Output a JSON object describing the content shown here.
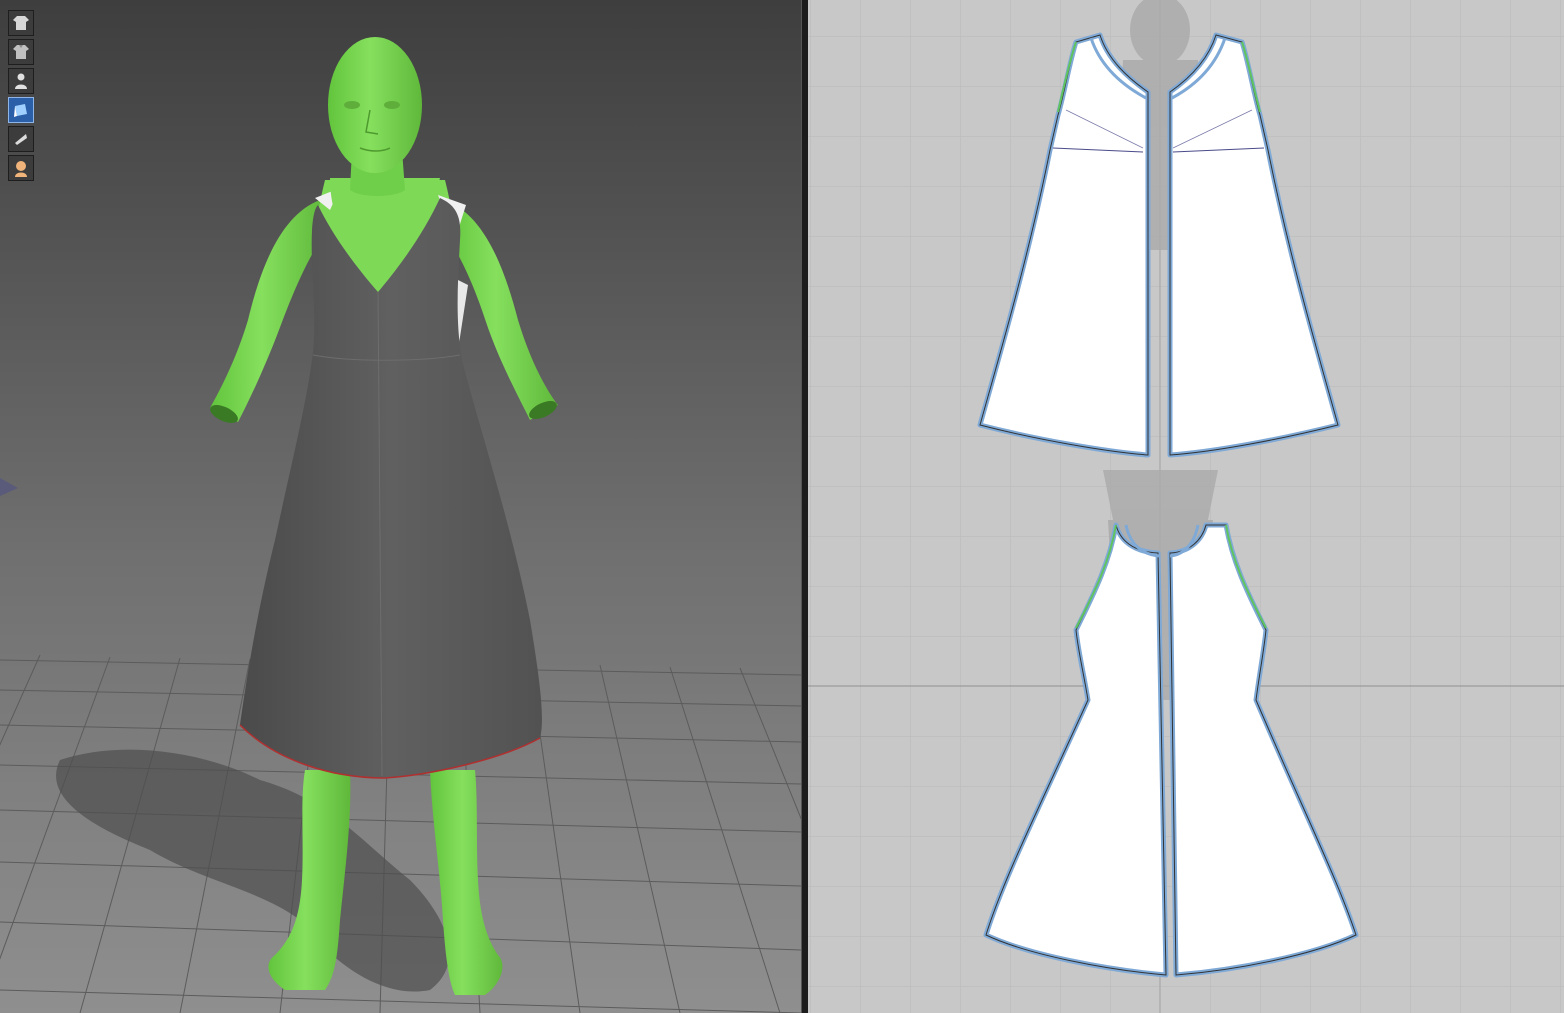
{
  "app": {
    "panels": [
      "3d-garment-view",
      "2d-pattern-view"
    ]
  },
  "toolbar_3d": {
    "items": [
      {
        "icon": "garment-front-icon",
        "active": false
      },
      {
        "icon": "garment-back-icon",
        "active": false
      },
      {
        "icon": "avatar-icon",
        "active": false
      },
      {
        "icon": "texture-icon",
        "active": true
      },
      {
        "icon": "flat-shading-icon",
        "active": false
      },
      {
        "icon": "skin-avatar-icon",
        "active": false
      }
    ]
  },
  "colors": {
    "avatar": "#7ed957",
    "garment": "#5e5e5e",
    "pattern_fill": "#ffffff",
    "pattern_outline": "#7fa9d6",
    "bg_3d_top": "#4a4a4a",
    "bg_3d_bottom": "#8a8a8a",
    "bg_2d": "#c8c8c8"
  },
  "pattern_pieces": [
    {
      "name": "front-left-panel"
    },
    {
      "name": "front-right-panel"
    },
    {
      "name": "back-left-panel"
    },
    {
      "name": "back-right-panel"
    }
  ]
}
